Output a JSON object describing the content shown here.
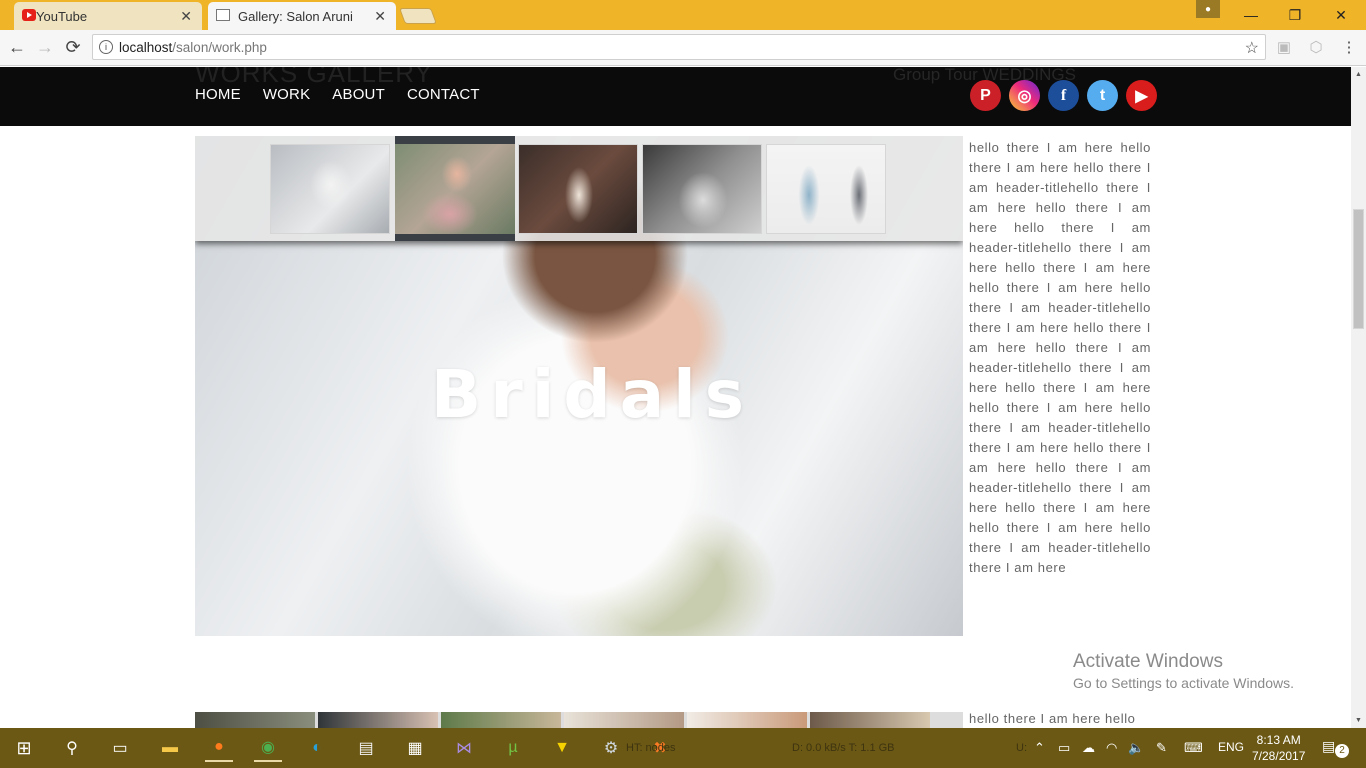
{
  "browser": {
    "tabs": [
      {
        "title": "YouTube",
        "active": false,
        "icon": "youtube-icon"
      },
      {
        "title": "Gallery: Salon Aruni",
        "active": true,
        "icon": "document-icon"
      }
    ],
    "close_glyph": "✕",
    "address": {
      "host": "localhost",
      "path": "/salon/work.php"
    },
    "nav_glyphs": {
      "back": "←",
      "forward": "→",
      "reload": "⟳",
      "info": "i",
      "star": "☆",
      "menu": "⋮"
    }
  },
  "site": {
    "ghost_title": "WORKS GALLERY",
    "ghost_right": "Group   Tour      WEDDINGS",
    "nav": [
      "HOME",
      "WORK",
      "ABOUT",
      "CONTACT"
    ],
    "social": [
      {
        "name": "pinterest",
        "glyph": "P"
      },
      {
        "name": "instagram",
        "glyph": "◎"
      },
      {
        "name": "facebook",
        "glyph": "f"
      },
      {
        "name": "twitter",
        "glyph": "t"
      },
      {
        "name": "youtube",
        "glyph": "▶"
      }
    ],
    "hero_label": "Bridals",
    "side_text": "hello there I am here hello there I am here hello there I am header-titlehello there I am here hello there I am here hello there I am header-titlehello there I am here hello there I am here hello there I am here hello there I am header-titlehello there I am here hello there I am here hello there I am header-titlehello there I am here hello there I am here hello there I am here hello there I am header-titlehello there I am here hello there I am here hello there I am header-titlehello there I am here hello there I am here hello there I am here hello there I am header-titlehello there I am here",
    "side_text2": "hello there I am here hello"
  },
  "watermark": {
    "line1": "Activate Windows",
    "line2": "Go to Settings to activate Windows."
  },
  "taskbar": {
    "ghost_left": "HT:  nodes",
    "ghost_mid": "D: 0.0 kB/s T: 1.1 GB",
    "ghost_right": "U:",
    "lang": "ENG",
    "time": "8:13 AM",
    "date": "7/28/2017",
    "notifications": "2"
  },
  "colors": {
    "tabbar": "#f0b429",
    "header": "#0b0b0b",
    "taskbar": "#6b5814"
  }
}
